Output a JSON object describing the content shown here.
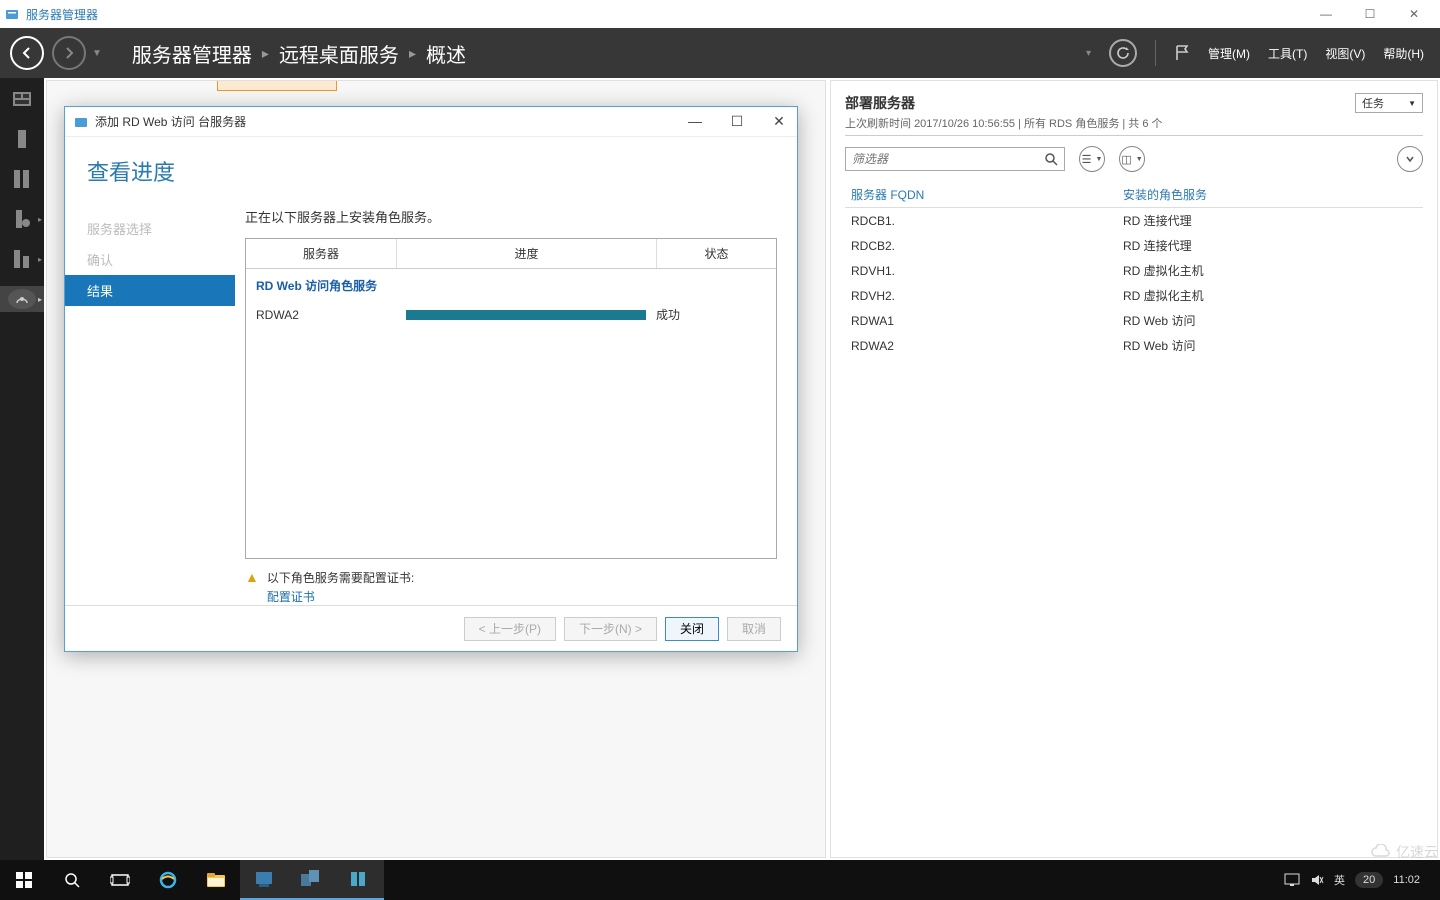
{
  "app": {
    "title": "服务器管理器"
  },
  "win_controls": {
    "min": "—",
    "max": "☐",
    "close": "✕"
  },
  "nav": {
    "crumbs": [
      "服务器管理器",
      "远程桌面服务",
      "概述"
    ],
    "menu": {
      "manage": "管理(M)",
      "tools": "工具(T)",
      "view": "视图(V)",
      "help": "帮助(H)"
    }
  },
  "deploy_panel": {
    "title": "部署服务器",
    "meta_prefix": "上次刷新时间 ",
    "meta_time": "2017/10/26 10:56:55",
    "meta_sep": " | ",
    "meta_roles": "所有 RDS 角色服务",
    "meta_count": " | 共 6 个",
    "tasks": "任务",
    "filter_placeholder": "筛选器",
    "columns": {
      "fqdn": "服务器 FQDN",
      "role": "安装的角色服务"
    },
    "rows": [
      {
        "fqdn": "RDCB1.",
        "role": "RD 连接代理"
      },
      {
        "fqdn": "RDCB2.",
        "role": "RD 连接代理"
      },
      {
        "fqdn": "RDVH1.",
        "role": "RD 虚拟化主机"
      },
      {
        "fqdn": "RDVH2.",
        "role": "RD 虚拟化主机"
      },
      {
        "fqdn": "RDWA1",
        "role": "RD Web 访问"
      },
      {
        "fqdn": "RDWA2",
        "role": "RD Web 访问"
      }
    ]
  },
  "dialog": {
    "title": "添加 RD Web 访问 台服务器",
    "heading": "查看进度",
    "steps": {
      "server_select": "服务器选择",
      "confirm": "确认",
      "result": "结果"
    },
    "desc": "正在以下服务器上安装角色服务。",
    "grid_headers": {
      "server": "服务器",
      "progress": "进度",
      "status": "状态"
    },
    "group": "RD Web 访问角色服务",
    "row": {
      "server": "RDWA2",
      "status": "成功"
    },
    "note_text": "以下角色服务需要配置证书:",
    "note_link": "配置证书",
    "buttons": {
      "prev": "< 上一步(P)",
      "next": "下一步(N) >",
      "close": "关闭",
      "cancel": "取消"
    }
  },
  "taskbar": {
    "ime": "英",
    "ime_num": "20",
    "clock": "11:02"
  },
  "watermark": "亿速云"
}
